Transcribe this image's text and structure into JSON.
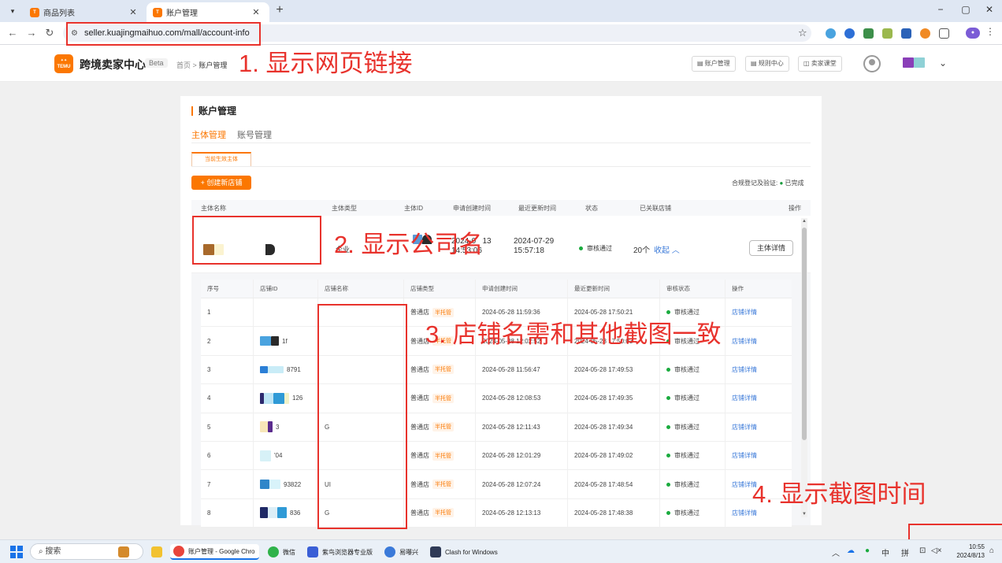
{
  "browser": {
    "tabs": [
      {
        "title": "商品列表",
        "active": false
      },
      {
        "title": "账户管理",
        "active": true
      }
    ],
    "url": "seller.kuajingmaihuo.com/mall/account-info",
    "window_controls": [
      "−",
      "▢",
      "✕"
    ]
  },
  "header": {
    "logo_text": "TEMU",
    "site_name": "跨境卖家中心",
    "beta": "Beta",
    "breadcrumb": {
      "home": "首页",
      "sep": ">",
      "current": "账户管理"
    },
    "buttons": [
      {
        "icon": "▤",
        "label": "账户管理"
      },
      {
        "icon": "▤",
        "label": "规则中心"
      },
      {
        "icon": "◫",
        "label": "卖家课堂"
      }
    ]
  },
  "page": {
    "title": "账户管理",
    "main_tabs": [
      "主体管理",
      "账号管理"
    ],
    "sub_tab": "当前生效主体",
    "create_button": "+ 创建新店铺",
    "compliance": {
      "label": "合规登记及验证:",
      "status": "已完成"
    },
    "columns": [
      "主体名称",
      "主体类型",
      "主体ID",
      "申请创建时间",
      "最近更新时间",
      "状态",
      "已关联店铺",
      "操作"
    ],
    "entity": {
      "type": "企业",
      "created_partial_1": "2024-0",
      "created_partial_2": "13",
      "created_partial_3": "14:53:06",
      "updated_date": "2024-07-29",
      "updated_time": "15:57:18",
      "status": "审核通过",
      "shop_count": "20个",
      "collapse": "收起 ︿",
      "detail_button": "主体详情"
    },
    "shop_columns": [
      "序号",
      "店铺ID",
      "店铺名称",
      "店铺类型",
      "申请创建时间",
      "最近更新时间",
      "审核状态",
      "操作"
    ],
    "shops": [
      {
        "no": "1",
        "id": "",
        "name": "",
        "type": "普通店",
        "tag": "半托管",
        "created": "2024-05-28 11:59:36",
        "updated": "2024-05-28 17:50:21",
        "status": "审核通过",
        "action": "店铺详情"
      },
      {
        "no": "2",
        "id": "1f",
        "name": "",
        "type": "普通店",
        "tag": "半托管",
        "created": "2024-05-28 12:02:52",
        "updated": "2024-05-28 17:50:03",
        "status": "审核通过",
        "action": "店铺详情"
      },
      {
        "no": "3",
        "id": "8791",
        "name": "",
        "type": "普通店",
        "tag": "半托管",
        "created": "2024-05-28 11:56:47",
        "updated": "2024-05-28 17:49:53",
        "status": "审核通过",
        "action": "店铺详情"
      },
      {
        "no": "4",
        "id": "126",
        "name": "",
        "type": "普通店",
        "tag": "半托管",
        "created": "2024-05-28 12:08:53",
        "updated": "2024-05-28 17:49:35",
        "status": "审核通过",
        "action": "店铺详情"
      },
      {
        "no": "5",
        "id": "3",
        "name": "G",
        "type": "普通店",
        "tag": "半托管",
        "created": "2024-05-28 12:11:43",
        "updated": "2024-05-28 17:49:34",
        "status": "审核通过",
        "action": "店铺详情"
      },
      {
        "no": "6",
        "id": "'04",
        "name": "",
        "type": "普通店",
        "tag": "半托管",
        "created": "2024-05-28 12:01:29",
        "updated": "2024-05-28 17:49:02",
        "status": "审核通过",
        "action": "店铺详情"
      },
      {
        "no": "7",
        "id": "93822",
        "name": "UI",
        "type": "普通店",
        "tag": "半托管",
        "created": "2024-05-28 12:07:24",
        "updated": "2024-05-28 17:48:54",
        "status": "审核通过",
        "action": "店铺详情"
      },
      {
        "no": "8",
        "id": "836",
        "name": "G",
        "type": "普通店",
        "tag": "半托管",
        "created": "2024-05-28 12:13:13",
        "updated": "2024-05-28 17:48:38",
        "status": "审核通过",
        "action": "店铺详情"
      }
    ]
  },
  "annotations": [
    "1. 显示网页链接",
    "2. 显示公司名",
    "3. 店铺名需和其他截图一致",
    "4. 显示截图时间"
  ],
  "taskbar": {
    "search": "搜索",
    "apps": [
      {
        "label": "账户管理 - Google Chro"
      },
      {
        "label": "微信"
      },
      {
        "label": "紫鸟浏览器专业版"
      },
      {
        "label": "易曝兴"
      },
      {
        "label": "Clash for Windows"
      }
    ],
    "tray": [
      "︿",
      "中",
      "拼"
    ],
    "time": "10:55",
    "date": "2024/8/13"
  },
  "colors": {
    "accent": "#fb7701",
    "annotation": "#e8322c",
    "success": "#1aab3e",
    "link": "#3b7ad9"
  }
}
